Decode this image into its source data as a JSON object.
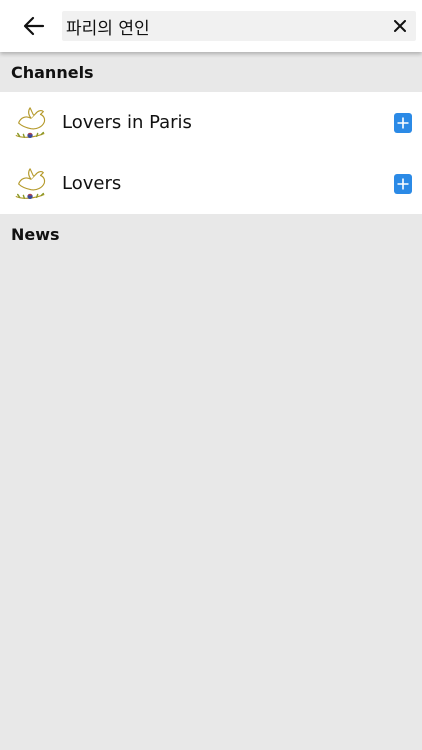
{
  "search": {
    "value": "파리의 연인",
    "back_icon": "arrow-left-icon",
    "clear_icon": "close-icon"
  },
  "sections": {
    "channels_title": "Channels",
    "news_title": "News"
  },
  "channels": [
    {
      "name": "Lovers in Paris",
      "avatar_icon": "dove-icon",
      "action_icon": "plus-icon"
    },
    {
      "name": "Lovers",
      "avatar_icon": "dove-icon",
      "action_icon": "plus-icon"
    }
  ],
  "colors": {
    "accent": "#2b8ae6",
    "background": "#e8e8e8",
    "surface": "#ffffff"
  }
}
